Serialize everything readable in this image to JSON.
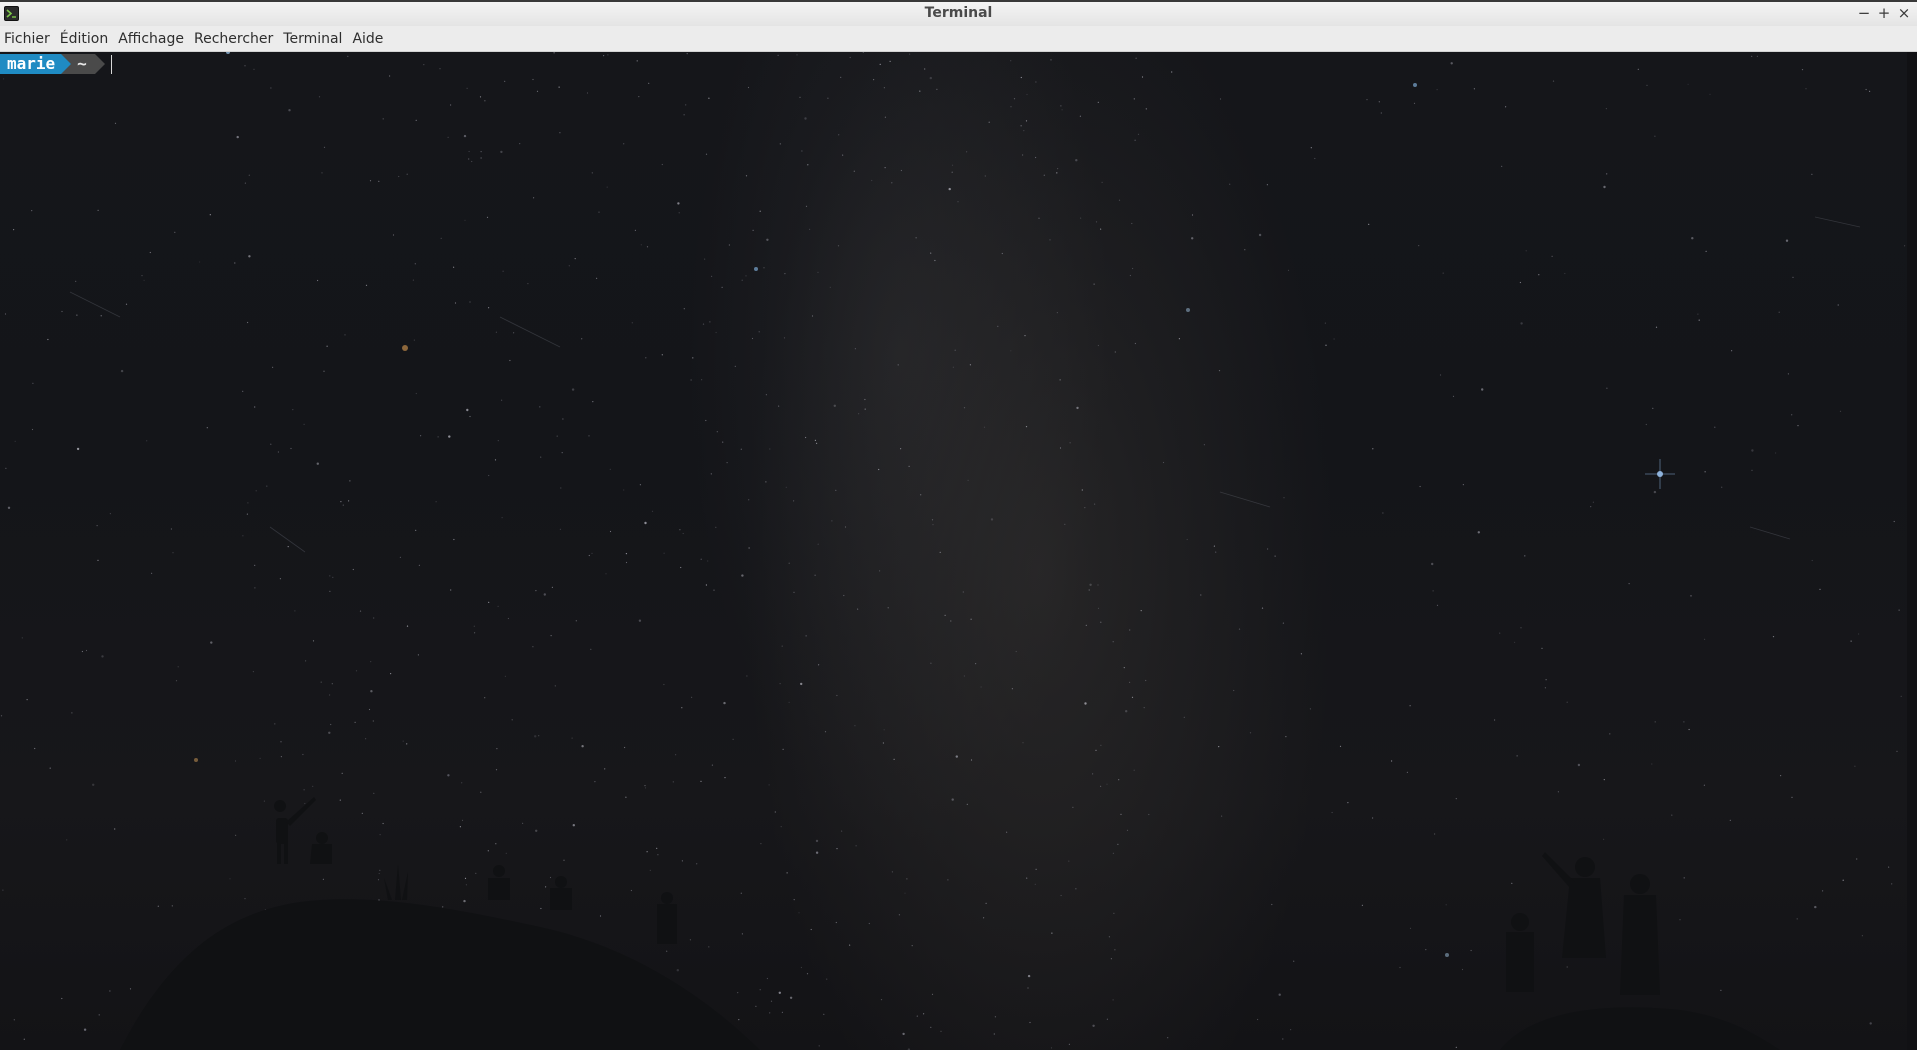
{
  "window": {
    "title": "Terminal",
    "controls": {
      "minimize": "−",
      "maximize": "+",
      "close": "×"
    },
    "app_icon": "terminal-app-icon"
  },
  "menubar": {
    "items": [
      {
        "label": "Fichier"
      },
      {
        "label": "Édition"
      },
      {
        "label": "Affichage"
      },
      {
        "label": "Rechercher"
      },
      {
        "label": "Terminal"
      },
      {
        "label": "Aide"
      }
    ]
  },
  "terminal": {
    "prompt": {
      "user": "marie",
      "directory": "~"
    },
    "colors": {
      "user_segment": "#1f8bc3",
      "dir_segment": "#4a4a4a",
      "background": "#141519"
    }
  }
}
